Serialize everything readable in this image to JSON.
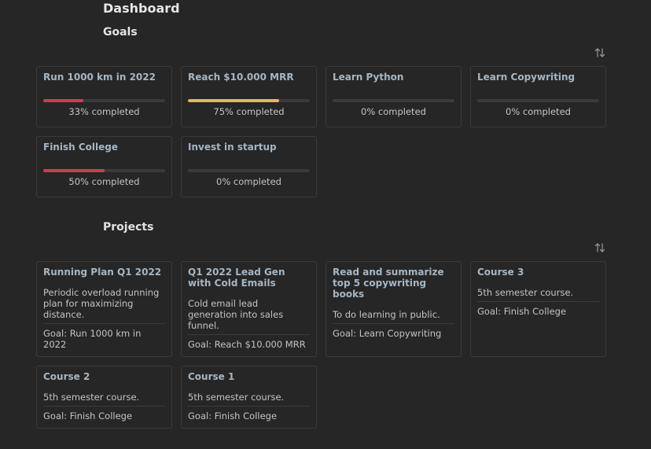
{
  "header": {
    "title": "Dashboard"
  },
  "goals": {
    "title": "Goals",
    "items": [
      {
        "title": "Run 1000 km in 2022",
        "progress": 33,
        "status": "33% completed",
        "color": "#c9404e"
      },
      {
        "title": "Reach $10.000 MRR",
        "progress": 75,
        "status": "75% completed",
        "color": "#e7b55c"
      },
      {
        "title": "Learn Python",
        "progress": 0,
        "status": "0% completed",
        "color": "#c9404e"
      },
      {
        "title": "Learn Copywriting",
        "progress": 0,
        "status": "0% completed",
        "color": "#c9404e"
      },
      {
        "title": "Finish College",
        "progress": 50,
        "status": "50% completed",
        "color": "#c9404e"
      },
      {
        "title": "Invest in startup",
        "progress": 0,
        "status": "0% completed",
        "color": "#c9404e"
      }
    ]
  },
  "projects": {
    "title": "Projects",
    "goal_prefix": "Goal: ",
    "items": [
      {
        "title": "Running Plan Q1 2022",
        "description": "Periodic overload running plan for maximizing distance.",
        "goal": "Run 1000 km in 2022"
      },
      {
        "title": "Q1 2022 Lead Gen with Cold Emails",
        "description": "Cold email lead generation into sales funnel.",
        "goal": "Reach $10.000 MRR"
      },
      {
        "title": "Read and summarize top 5 copywriting books",
        "description": "To do learning in public.",
        "goal": "Learn Copywriting"
      },
      {
        "title": "Course 3",
        "description": "5th semester course.",
        "goal": "Finish College"
      },
      {
        "title": "Course 2",
        "description": "5th semester course.",
        "goal": "Finish College"
      },
      {
        "title": "Course 1",
        "description": "5th semester course.",
        "goal": "Finish College"
      }
    ]
  },
  "icons": {
    "sort": "sort-arrows-icon"
  }
}
